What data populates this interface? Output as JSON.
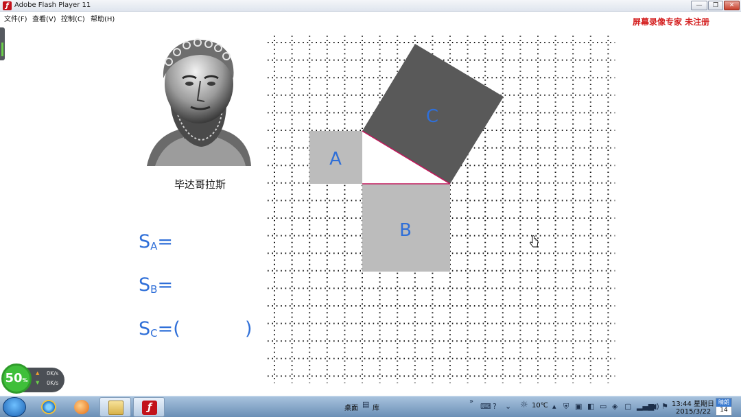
{
  "window": {
    "title": "Adobe Flash Player 11",
    "icon": "flash-icon",
    "minimize_glyph": "—",
    "restore_glyph": "❐",
    "close_glyph": "✕"
  },
  "menu": [
    {
      "label": "文件(F)"
    },
    {
      "label": "查看(V)"
    },
    {
      "label": "控制(C)"
    },
    {
      "label": "帮助(H)"
    }
  ],
  "watermark": "屏幕录像专家  未注册",
  "portrait": {
    "caption": "毕达哥拉斯"
  },
  "squares": {
    "a_label": "A",
    "b_label": "B",
    "c_label": "C"
  },
  "formulas": {
    "sa_prefix": "S",
    "sa_sub": "A",
    "sa_suffix": "=",
    "sb_prefix": "S",
    "sb_sub": "B",
    "sb_suffix": "=",
    "sc_prefix": "S",
    "sc_sub": "C",
    "sc_suffix": "=(",
    "sc_close": ")"
  },
  "speed_widget": {
    "percent": "50",
    "percent_unit": "%",
    "up": "0K/s",
    "down": "0K/s"
  },
  "taskbar": {
    "desktop_label": "桌面",
    "library_label": "库",
    "apps": [
      "internet-explorer-icon",
      "media-player-icon",
      "file-explorer-icon",
      "flash-player-icon"
    ],
    "temperature": "10℃",
    "time": "13:44 星期日",
    "date": "2015/3/22",
    "weather_condition": "晴朗",
    "weather_day": "14"
  },
  "colors": {
    "formula_blue": "#2f6fd8",
    "square_light": "#bcbcbc",
    "square_dark": "#595959",
    "triangle_edge": "#c2185b",
    "watermark_red": "#d42020"
  }
}
